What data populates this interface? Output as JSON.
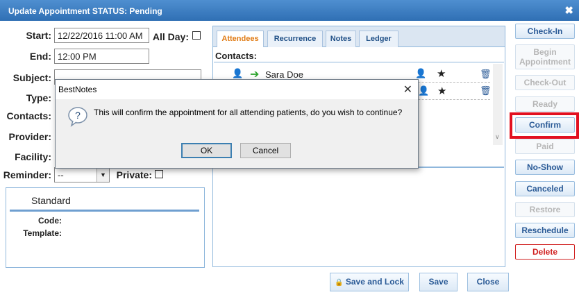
{
  "window": {
    "title": "Update Appointment STATUS: Pending"
  },
  "form": {
    "start_label": "Start:",
    "start_value": "12/22/2016 11:00 AM",
    "allday_label": "All Day:",
    "end_label": "End:",
    "end_value": "12:00 PM",
    "subject_label": "Subject:",
    "type_label": "Type:",
    "contacts_label": "Contacts:",
    "provider_label": "Provider:",
    "facility_label": "Facility:",
    "reminder_label": "Reminder:",
    "reminder_value": "--",
    "private_label": "Private:"
  },
  "standard": {
    "title": "Standard",
    "code_label": "Code:",
    "template_label": "Template:"
  },
  "tabs": [
    {
      "label": "Attendees"
    },
    {
      "label": "Recurrence"
    },
    {
      "label": "Notes"
    },
    {
      "label": "Ledger"
    }
  ],
  "attendees": {
    "contacts_heading": "Contacts:",
    "rows": [
      {
        "name": "Sara Doe"
      }
    ]
  },
  "side_buttons": {
    "check_in": "Check-In",
    "begin": "Begin Appointment",
    "check_out": "Check-Out",
    "ready": "Ready",
    "confirm": "Confirm",
    "paid": "Paid",
    "no_show": "No-Show",
    "canceled": "Canceled",
    "restore": "Restore",
    "reschedule": "Reschedule",
    "delete": "Delete"
  },
  "bottom_buttons": {
    "save_lock": "Save and Lock",
    "save": "Save",
    "close": "Close"
  },
  "dialog": {
    "title": "BestNotes",
    "message": "This will confirm the appointment for all attending patients, do you wish to continue?",
    "ok": "OK",
    "cancel": "Cancel"
  },
  "colors": {
    "title_bar": "#3a7cc0",
    "active_tab": "#e07a12",
    "highlight": "#e21020",
    "delete": "#d12020"
  }
}
